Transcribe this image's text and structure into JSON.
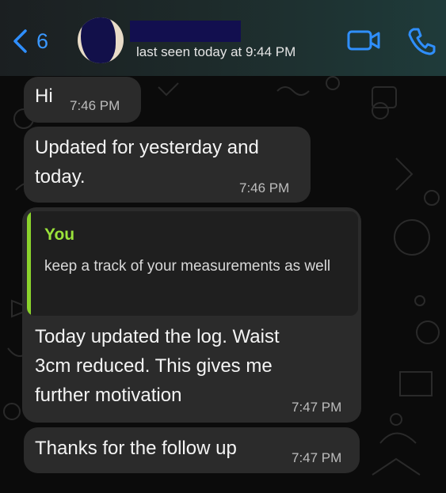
{
  "header": {
    "back_count": "6",
    "last_seen": "last seen today at 9:44 PM",
    "video_icon": "video-camera-icon",
    "call_icon": "phone-icon",
    "accent": "#2f8fff"
  },
  "messages": [
    {
      "text": "Hi",
      "time": "7:46 PM"
    },
    {
      "text": "Updated for yesterday and today.",
      "time": "7:46 PM"
    },
    {
      "quote_sender": "You",
      "quote_text": "keep a track of your measurements as well",
      "text": "Today updated the log. Waist 3cm reduced. This gives me further motivation",
      "time": "7:47 PM"
    },
    {
      "text": "Thanks for the follow up",
      "time": "7:47 PM"
    }
  ],
  "colors": {
    "bubble": "#2b2b2b",
    "quote_accent": "#8bd32c",
    "background": "#0b0b0b"
  }
}
